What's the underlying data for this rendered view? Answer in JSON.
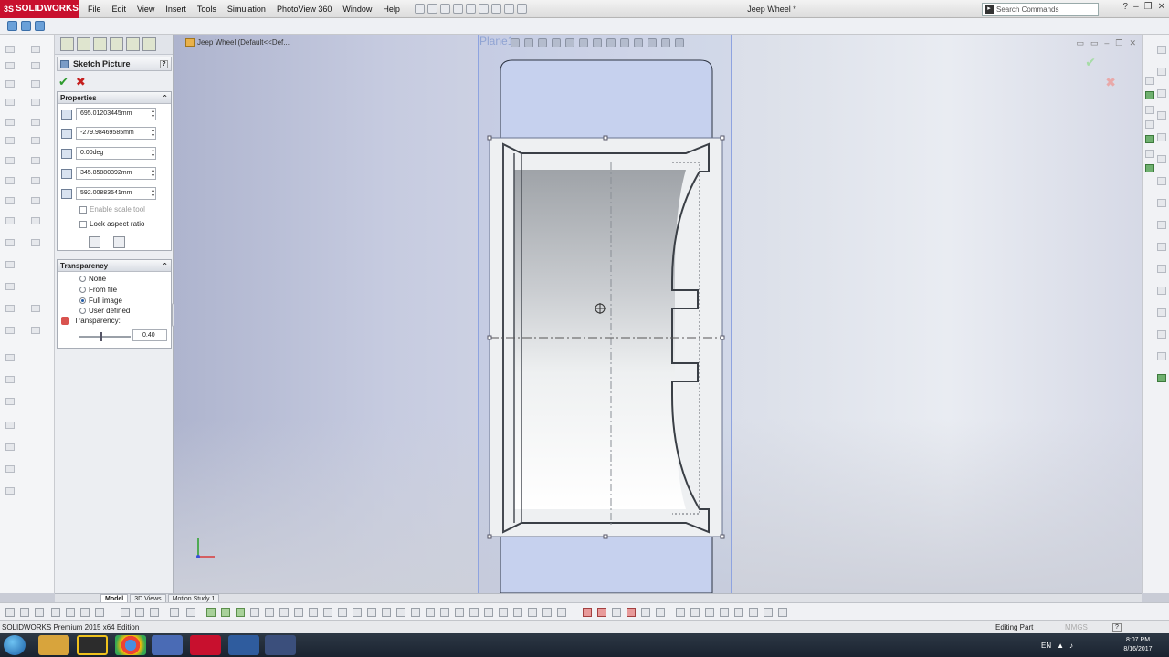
{
  "app": {
    "brand": "SOLIDWORKS",
    "title": "Jeep Wheel *",
    "menu": [
      "File",
      "Edit",
      "View",
      "Insert",
      "Tools",
      "Simulation",
      "PhotoView 360",
      "Window",
      "Help"
    ],
    "search_placeholder": "Search Commands"
  },
  "feature_tree": {
    "root": "Jeep Wheel  (Default<<Def..."
  },
  "viewport": {
    "plane_label": "Plane1"
  },
  "property_manager": {
    "title": "Sketch Picture",
    "properties_title": "Properties",
    "fields": [
      {
        "name": "origin-x",
        "value": "695.01203445mm"
      },
      {
        "name": "origin-y",
        "value": "-279.98469585mm"
      },
      {
        "name": "angle",
        "value": "0.00deg"
      },
      {
        "name": "width",
        "value": "345.85880392mm"
      },
      {
        "name": "height",
        "value": "592.00883541mm"
      }
    ],
    "enable_scale_tool": "Enable scale tool",
    "lock_aspect_ratio": "Lock aspect ratio",
    "transparency_title": "Transparency",
    "transparency_options": [
      "None",
      "From file",
      "Full image",
      "User defined"
    ],
    "transparency_selected": "Full image",
    "transparency_label": "Transparency:",
    "transparency_value": "0.40"
  },
  "bottom_tabs": [
    "Model",
    "3D Views",
    "Motion Study 1"
  ],
  "status": {
    "edition": "SOLIDWORKS Premium 2015 x64 Edition",
    "mode": "Editing Part",
    "units": "MMGS"
  },
  "taskbar": {
    "lang": "EN",
    "time": "8:07 PM",
    "date": "8/16/2017"
  },
  "colors": {
    "brand": "#c8102e",
    "plane": "#8ea3e0",
    "ok": "#2e9b2e",
    "cancel": "#c51e1e"
  }
}
